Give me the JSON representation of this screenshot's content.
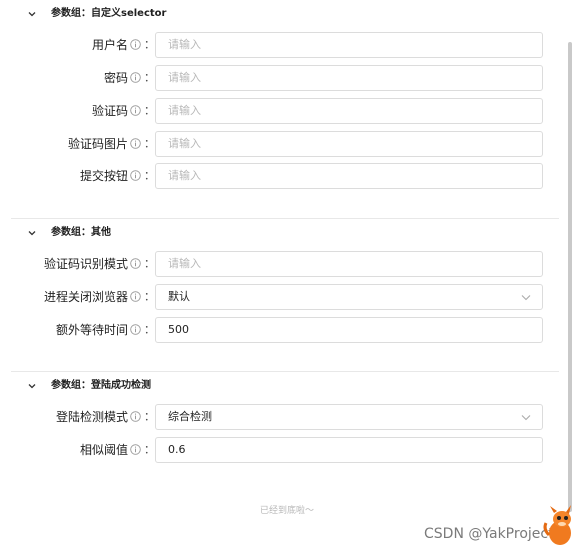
{
  "groups": [
    {
      "title": "参数组：自定义selector",
      "fields": [
        {
          "label": "用户名",
          "placeholder": "请输入"
        },
        {
          "label": "密码",
          "placeholder": "请输入"
        },
        {
          "label": "验证码",
          "placeholder": "请输入"
        },
        {
          "label": "验证码图片",
          "placeholder": "请输入"
        },
        {
          "label": "提交按钮",
          "placeholder": "请输入"
        }
      ]
    },
    {
      "title": "参数组：其他",
      "fields": [
        {
          "label": "验证码识别模式",
          "placeholder": "请输入"
        },
        {
          "label": "进程关闭浏览器",
          "value": "默认",
          "type": "select"
        },
        {
          "label": "额外等待时间",
          "value": "500"
        }
      ]
    },
    {
      "title": "参数组：登陆成功检测",
      "fields": [
        {
          "label": "登陆检测模式",
          "value": "综合检测",
          "type": "select"
        },
        {
          "label": "相似阈值",
          "value": "0.6"
        }
      ]
    }
  ],
  "colon": "：",
  "footer": {
    "end_text": "已经到底啦～"
  },
  "watermark": "CSDN @YakProject",
  "icons": {
    "collapse": "chevron-down-icon",
    "info": "info-circle-icon",
    "select": "chevron-down-icon",
    "mascot": "mascot-icon"
  }
}
